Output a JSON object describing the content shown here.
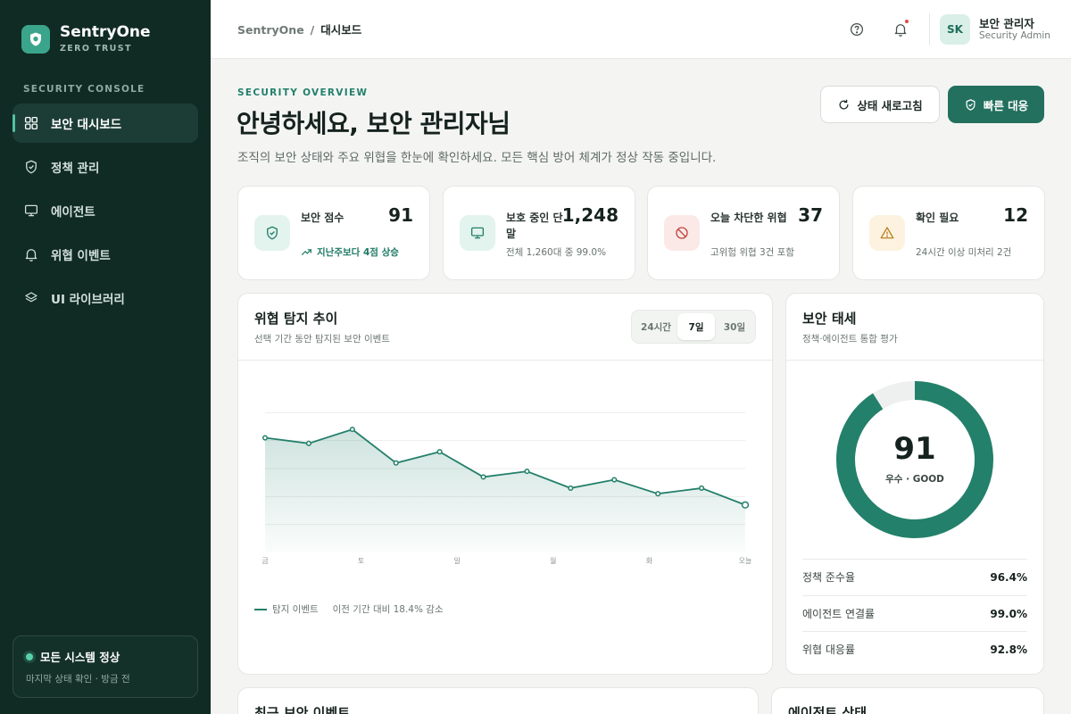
{
  "brand": {
    "name": "SentryOne",
    "sub": "ZERO TRUST"
  },
  "sidebar": {
    "section_label": "SECURITY CONSOLE",
    "items": [
      {
        "label": "보안 대시보드",
        "icon": "grid-icon",
        "active": true
      },
      {
        "label": "정책 관리",
        "icon": "shield-check-icon",
        "active": false
      },
      {
        "label": "에이전트",
        "icon": "monitor-icon",
        "active": false
      },
      {
        "label": "위협 이벤트",
        "icon": "bell-icon",
        "active": false
      },
      {
        "label": "UI 라이브러리",
        "icon": "layers-icon",
        "active": false
      }
    ],
    "status": {
      "title": "모든 시스템 정상",
      "sub": "마지막 상태 확인 · 방금 전"
    }
  },
  "topbar": {
    "breadcrumb_root": "SentryOne",
    "breadcrumb_sep": "/",
    "breadcrumb_current": "대시보드",
    "user": {
      "initials": "SK",
      "name": "보안 관리자",
      "role": "Security Admin"
    }
  },
  "overview": {
    "label": "SECURITY OVERVIEW",
    "greeting": "안녕하세요, 보안 관리자님",
    "subtitle": "조직의 보안 상태와 주요 위협을 한눈에 확인하세요. 모든 핵심 방어 체계가 정상 작동 중입니다.",
    "refresh_label": "상태 새로고침",
    "quick_label": "빠른 대응"
  },
  "stats": [
    {
      "label": "보안 점수",
      "value": "91",
      "sub": "지난주보다 4점 상승",
      "icon": "shield-check-icon",
      "accent": "#23806a",
      "bg": "#e3f3ed"
    },
    {
      "label": "보호 중인 단말",
      "value": "1,248",
      "sub": "전체 1,260대 중 99.0%",
      "icon": "monitor-icon",
      "accent": "#23806a",
      "bg": "#e3f3ed"
    },
    {
      "label": "오늘 차단한 위협",
      "value": "37",
      "sub": "고위험 위협 3건 포함",
      "icon": "block-icon",
      "accent": "#c2453d",
      "bg": "#fbe9e7"
    },
    {
      "label": "확인 필요",
      "value": "12",
      "sub": "24시간 이상 미처리 2건",
      "icon": "warning-icon",
      "accent": "#b9832a",
      "bg": "#fdf2df"
    }
  ],
  "trend": {
    "title": "위협 탐지 추이",
    "sub": "선택 기간 동안 탐지된 보안 이벤트",
    "tabs": [
      "24시간",
      "7일",
      "30일"
    ],
    "active_tab": 1,
    "legend": "탐지 이벤트",
    "note": "이전 기간 대비 18.4% 감소"
  },
  "chart_data": {
    "type": "area",
    "x": [
      "금",
      "토",
      "일",
      "월",
      "화",
      "오늘"
    ],
    "series": [
      {
        "values": [
          31,
          29,
          34,
          22,
          26,
          17,
          19,
          13,
          16,
          11,
          13,
          7
        ]
      }
    ],
    "ylim": [
      -10,
      50
    ],
    "grid": true,
    "color": "#23806a"
  },
  "posture": {
    "title": "보안 태세",
    "sub": "정책·에이전트 통합 평가",
    "score": 91,
    "score_label": "91",
    "grade": "우수 · GOOD",
    "color": "#23806a",
    "track_color": "#edf0ee",
    "metrics": [
      {
        "label": "정책 준수율",
        "value": "96.4%"
      },
      {
        "label": "에이전트 연결률",
        "value": "99.0%"
      },
      {
        "label": "위협 대응률",
        "value": "92.8%"
      }
    ]
  },
  "bottom": {
    "events_title": "최근 보안 이벤트",
    "agents_title": "에이전트 상태"
  }
}
